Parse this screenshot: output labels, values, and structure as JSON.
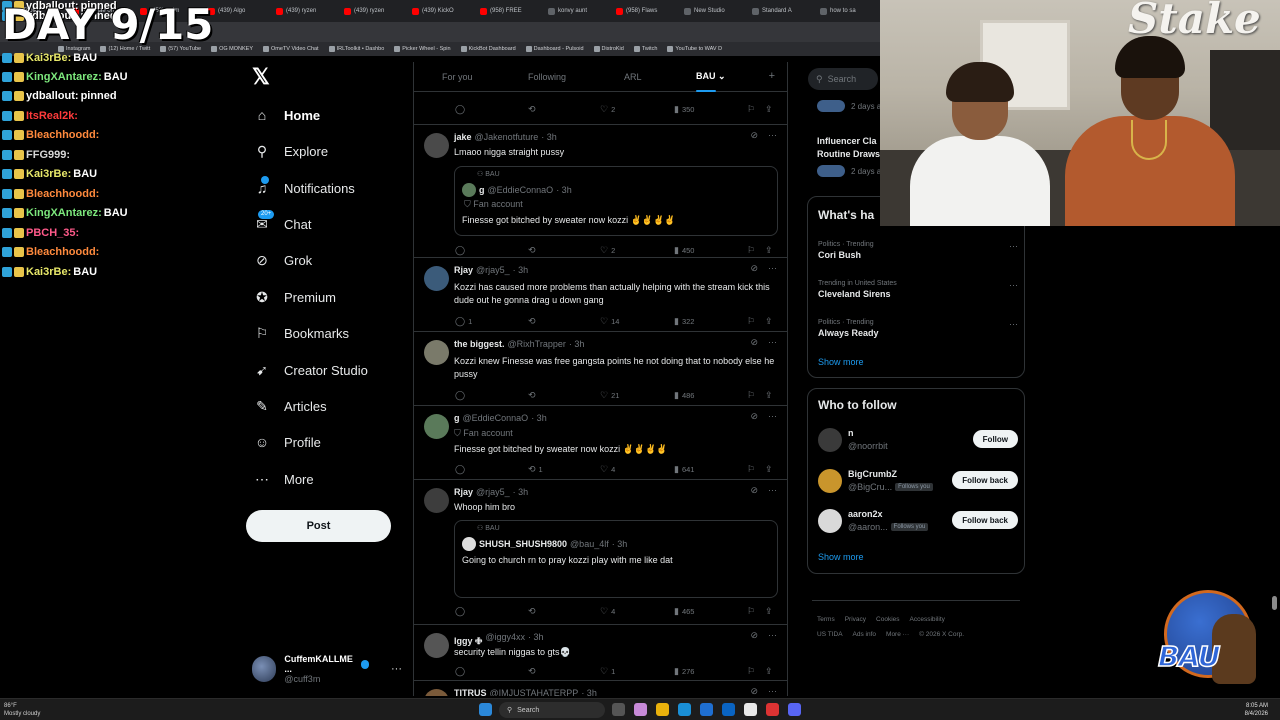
{
  "overlay": {
    "day_counter": "DAY 9/15",
    "chat": [
      {
        "user": "ydballout:",
        "message": "pinned",
        "color": "#ffffff"
      },
      {
        "user": "ydballout:",
        "message": "pinned",
        "color": "#ffffff"
      },
      {
        "user": "Kai3rBe:",
        "message": "BAU",
        "color": "#e8e86a"
      },
      {
        "user": "KingXAntarez:",
        "message": "BAU",
        "color": "#7de87d"
      },
      {
        "user": "ydballout:",
        "message": "pinned",
        "color": "#ffffff"
      },
      {
        "user": "ItsReal2k:",
        "message": "",
        "color": "#ff3b3b"
      },
      {
        "user": "Bleachhoodd:",
        "message": "",
        "color": "#ff8a3d"
      },
      {
        "user": "FFG999:",
        "message": "",
        "color": "#d7d7d7"
      },
      {
        "user": "Kai3rBe:",
        "message": "BAU",
        "color": "#e8e86a"
      },
      {
        "user": "Bleachhoodd:",
        "message": "",
        "color": "#ff8a3d"
      },
      {
        "user": "KingXAntarez:",
        "message": "BAU",
        "color": "#7de87d"
      },
      {
        "user": "PBCH_35:",
        "message": "",
        "color": "#ff5a8a"
      },
      {
        "user": "Bleachhoodd:",
        "message": "",
        "color": "#ff8a3d"
      },
      {
        "user": "Kai3rBe:",
        "message": "BAU",
        "color": "#e8e86a"
      }
    ]
  },
  "browser": {
    "tabs": [
      "IRLToolkit",
      "(438) jae on",
      "(958) swim",
      "(439) Algo",
      "(439) ryzen",
      "(439) ryzen",
      "(439) KickO",
      "(958) FREE",
      "konvy aunt",
      "(958) Flaws",
      "New Studio",
      "Standard A",
      "how to sa"
    ],
    "bookmarks": [
      "Instagram",
      "(12) Home / Twitt",
      "(57) YouTube",
      "OG MONKEY",
      "OmeTV Video Chat",
      "IRLToolkit • Dashbo",
      "Picker Wheel - Spin",
      "KickBot Dashboard",
      "Dashboard - Pulsoid",
      "DistroKid",
      "Twitch",
      "YouTube to WAV D"
    ]
  },
  "nav": {
    "items": [
      {
        "label": "Home",
        "icon": "home-icon",
        "glyph": "⌂"
      },
      {
        "label": "Explore",
        "icon": "search-icon",
        "glyph": "⚲"
      },
      {
        "label": "Notifications",
        "icon": "bell-icon",
        "glyph": "♫"
      },
      {
        "label": "Chat",
        "icon": "chat-icon",
        "glyph": "✉"
      },
      {
        "label": "Grok",
        "icon": "grok-icon",
        "glyph": "⊘"
      },
      {
        "label": "Premium",
        "icon": "premium-icon",
        "glyph": "✪"
      },
      {
        "label": "Bookmarks",
        "icon": "bookmark-icon",
        "glyph": "⚐"
      },
      {
        "label": "Creator Studio",
        "icon": "rocket-icon",
        "glyph": "➹"
      },
      {
        "label": "Articles",
        "icon": "articles-icon",
        "glyph": "✎"
      },
      {
        "label": "Profile",
        "icon": "person-icon",
        "glyph": "☺"
      },
      {
        "label": "More",
        "icon": "more-icon",
        "glyph": "⋯"
      }
    ],
    "chat_badge": "20+",
    "post_label": "Post",
    "account": {
      "name": "CuffemKALLME ...",
      "handle": "@cuff3m",
      "more": "···"
    }
  },
  "timeline": {
    "tabs": [
      "For you",
      "Following",
      "ARL",
      "BAU"
    ],
    "active_tab": "BAU",
    "tweets": [
      {
        "name": "",
        "handle": "",
        "time": "",
        "text": "",
        "replies": "",
        "reposts": "",
        "likes": "2",
        "views": "350"
      },
      {
        "name": "jake",
        "handle": "@Jakenotfuture",
        "time": "· 3h",
        "text": "Lmaoo nigga straight pussy",
        "quote": {
          "context": "BAU",
          "name": "g",
          "handle": "@EddieConnaO",
          "time": "· 3h",
          "sub": "Fan account",
          "text": "Finesse got bitched by sweater now kozzi ✌️✌️✌️✌️"
        },
        "replies": "",
        "reposts": "",
        "likes": "2",
        "views": "450"
      },
      {
        "name": "Rjay",
        "handle": "@rjay5_",
        "time": "· 3h",
        "text": "Kozzi has caused more problems than actually helping with the stream kick this dude out he gonna drag u down gang",
        "replies": "1",
        "reposts": "",
        "likes": "14",
        "views": "322"
      },
      {
        "name": "the biggest.",
        "handle": "@RixhTrapper",
        "time": "· 3h",
        "text": "Kozzi knew Finesse was free gangsta points he not doing that to nobody else he pussy",
        "replies": "",
        "reposts": "",
        "likes": "21",
        "views": "486"
      },
      {
        "name": "g",
        "handle": "@EddieConnaO",
        "time": "· 3h",
        "sub": "Fan account",
        "text": "Finesse got bitched by sweater now kozzi ✌️✌️✌️✌️",
        "replies": "",
        "reposts": "1",
        "likes": "4",
        "views": "641"
      },
      {
        "name": "Rjay",
        "handle": "@rjay5_",
        "time": "· 3h",
        "text": "Whoop him bro",
        "quote": {
          "context": "BAU",
          "name": "SHUSH_SHUSH9800",
          "handle": "@bau_4lf",
          "time": "· 3h",
          "sub": "",
          "text": "Going to church rn to pray kozzi play with me like dat"
        },
        "replies": "",
        "reposts": "",
        "likes": "4",
        "views": "465"
      },
      {
        "name": "Iggy 🜋",
        "handle": "@iggy4xx",
        "time": "· 3h",
        "text": "security tellin niggas to gts💀",
        "replies": "",
        "reposts": "",
        "likes": "1",
        "views": "276"
      },
      {
        "name": "TITRUS",
        "handle": "@IMJUSTAHATERPP",
        "time": "· 3h",
        "text": "",
        "replies": "",
        "reposts": "",
        "likes": "",
        "views": ""
      }
    ]
  },
  "sidebar": {
    "search_placeholder": "Search",
    "partial_top": {
      "meta1": "2 days a",
      "title": "Influencer Cla",
      "title2": "Routine Draws",
      "meta2": "2 days a"
    },
    "trends_title": "What's ha",
    "trends": [
      {
        "meta": "Politics · Trending",
        "name": "Cori Bush"
      },
      {
        "meta": "Trending in United States",
        "name": "Cleveland Sirens"
      },
      {
        "meta": "Politics · Trending",
        "name": "Always Ready"
      }
    ],
    "show_more": "Show more",
    "wtf_title": "Who to follow",
    "who_to_follow": [
      {
        "name": "n",
        "handle": "@noorrbit",
        "follows_you": "",
        "button": "Follow",
        "avatar_color": "#3a3a3a"
      },
      {
        "name": "BigCrumbZ",
        "handle": "@BigCru...",
        "follows_you": "Follows you",
        "button": "Follow back",
        "avatar_color": "#c9952c"
      },
      {
        "name": "aaron2x",
        "handle": "@aaron...",
        "follows_you": "Follows you",
        "button": "Follow back",
        "avatar_color": "#d9d9d9"
      }
    ],
    "footer": [
      "Terms",
      "Privacy",
      "Cookies",
      "Accessibility",
      "US TIDA",
      "Ads info",
      "More ···",
      "© 2026 X Corp."
    ]
  },
  "taskbar": {
    "weather_temp": "86°F",
    "weather_desc": "Mostly cloudy",
    "search": "Search",
    "time": "8:05 AM",
    "date": "8/4/2026"
  },
  "logo": {
    "text": "BAU"
  },
  "colors": {
    "accent": "#1d9bf0",
    "background": "#000000",
    "border": "#2f3336",
    "muted": "#71767b"
  }
}
